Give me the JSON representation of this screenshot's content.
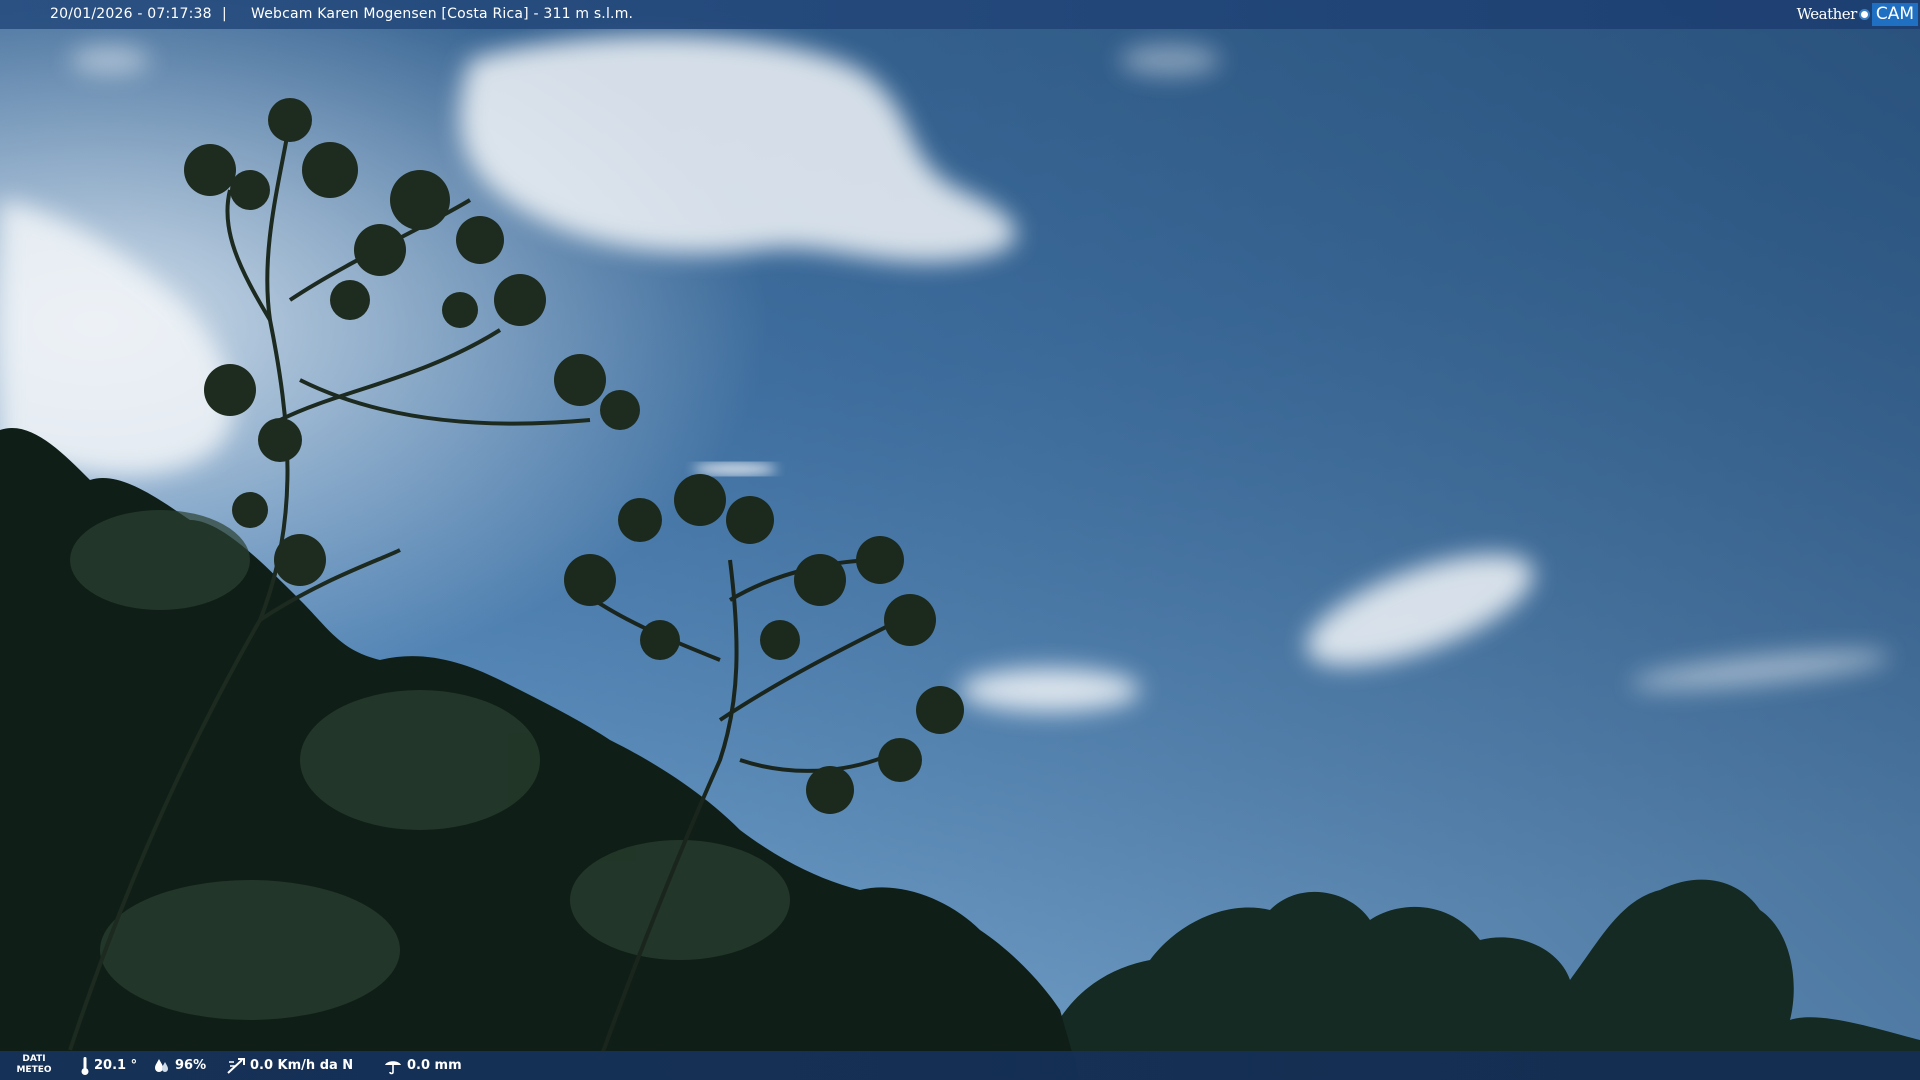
{
  "header": {
    "timestamp": "20/01/2026 - 07:17:38",
    "separator": "|",
    "caption": "Webcam Karen Mogensen [Costa Rica]  - 311 m s.l.m."
  },
  "logo": {
    "weather_text": "Weather",
    "cam_text": "CAM"
  },
  "footer": {
    "dati_line1": "DATI",
    "dati_line2": "METEO",
    "temperature": "20.1 °",
    "humidity": "96%",
    "wind": "0.0 Km/h da N",
    "rain": "0.0 mm"
  },
  "icons": {
    "temperature": "thermometer-icon",
    "humidity": "humidity-icon",
    "wind": "wind-icon",
    "rain": "rain-gauge-icon"
  },
  "colors": {
    "header_bg": "#284e80",
    "footer_bg": "#16325a",
    "sky_top": "#2f5a8a",
    "sky_bottom": "#5f94c4",
    "logo_accent": "#1f6fc2"
  }
}
